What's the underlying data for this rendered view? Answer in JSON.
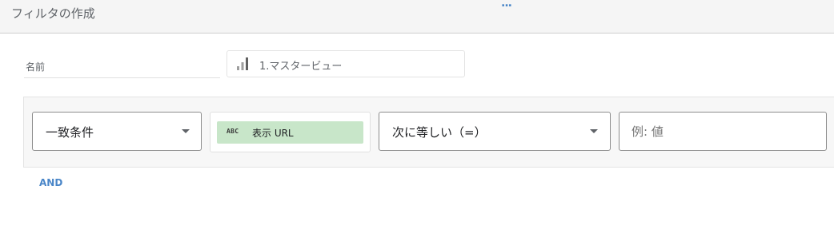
{
  "header": {
    "title": "フィルタの作成",
    "dots": "..."
  },
  "name_field": {
    "label": "名前"
  },
  "view": {
    "icon": "bar-chart-icon",
    "label": "1.マスタービュー"
  },
  "condition": {
    "match_type": "一致条件",
    "dimension": {
      "type_badge": "ABC",
      "label": "表示 URL",
      "color": "#c8e6c9"
    },
    "operator": "次に等しい（=）",
    "value_placeholder": "例: 値"
  },
  "and_label": "AND"
}
